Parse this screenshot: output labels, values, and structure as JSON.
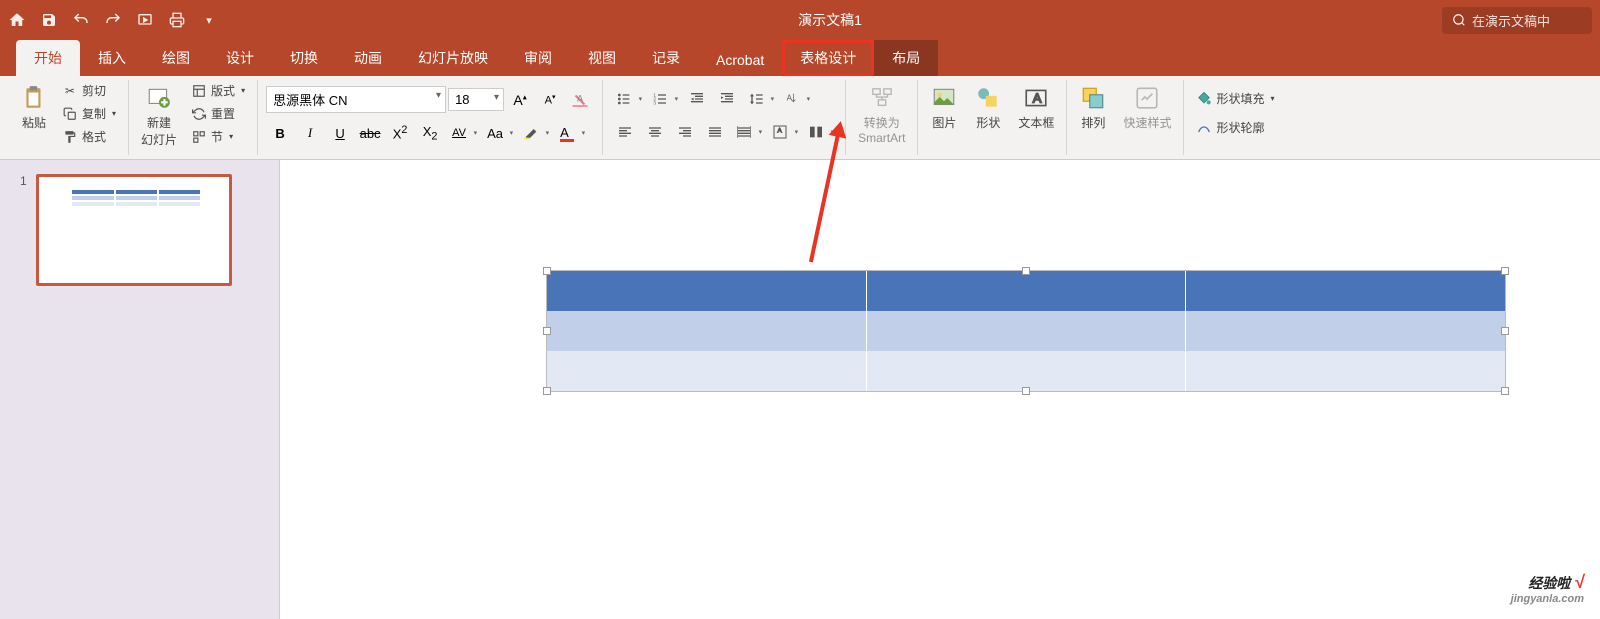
{
  "title": "演示文稿1",
  "search_placeholder": "在演示文稿中",
  "tabs": [
    {
      "label": "开始",
      "active": true
    },
    {
      "label": "插入"
    },
    {
      "label": "绘图"
    },
    {
      "label": "设计"
    },
    {
      "label": "切换"
    },
    {
      "label": "动画"
    },
    {
      "label": "幻灯片放映"
    },
    {
      "label": "审阅"
    },
    {
      "label": "视图"
    },
    {
      "label": "记录"
    },
    {
      "label": "Acrobat"
    },
    {
      "label": "表格设计",
      "highlight": true
    },
    {
      "label": "布局",
      "dark": true
    }
  ],
  "ribbon": {
    "paste": "粘贴",
    "cut": "剪切",
    "copy": "复制",
    "format": "格式",
    "new_slide": "新建\n幻灯片",
    "layout": "版式",
    "reset": "重置",
    "section": "节",
    "font_name": "思源黑体 CN",
    "font_size": "18",
    "convert_smartart": "转换为\nSmartArt",
    "picture": "图片",
    "shapes": "形状",
    "textbox": "文本框",
    "arrange": "排列",
    "quick_style": "快速样式",
    "shape_fill": "形状填充",
    "shape_outline": "形状轮廓"
  },
  "slide_number": "1",
  "watermark": {
    "line1": "经验啦",
    "line2": "jingyanla.com"
  }
}
